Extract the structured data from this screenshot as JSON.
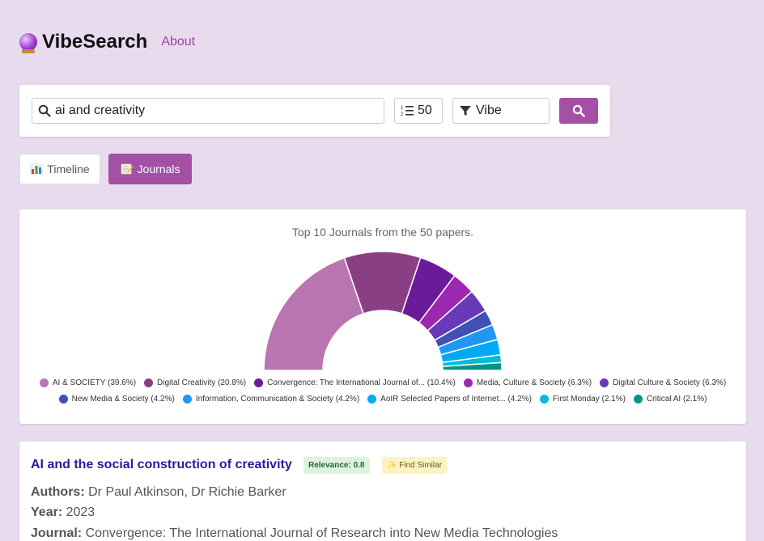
{
  "header": {
    "brand": "VibeSearch",
    "about": "About"
  },
  "search": {
    "query": "ai and creativity",
    "count": "50",
    "mode": "Vibe"
  },
  "tabs": {
    "timeline": "Timeline",
    "journals": "Journals"
  },
  "chart_title": "Top 10 Journals from the 50 papers.",
  "chart_data": {
    "type": "pie",
    "title": "Top 10 Journals from the 50 papers.",
    "categories": [
      "AI & SOCIETY",
      "Digital Creativity",
      "Convergence: The International Journal of...",
      "Media, Culture & Society",
      "Digital Culture & Society",
      "New Media & Society",
      "Information, Communication & Society",
      "AoIR Selected Papers of Internet...",
      "First Monday",
      "Critical AI"
    ],
    "values": [
      39.6,
      20.8,
      10.4,
      6.3,
      6.3,
      4.2,
      4.2,
      4.2,
      2.1,
      2.1
    ],
    "colors": [
      "#b974b2",
      "#8a3f85",
      "#6a1b9a",
      "#9c27b0",
      "#673ab7",
      "#3f51b5",
      "#2196f3",
      "#03a9f4",
      "#00bcd4",
      "#009688"
    ],
    "legend_labels": [
      "AI & SOCIETY (39.6%)",
      "Digital Creativity (20.8%)",
      "Convergence: The International Journal of... (10.4%)",
      "Media, Culture & Society (6.3%)",
      "Digital Culture & Society (6.3%)",
      "New Media & Society (4.2%)",
      "Information, Communication & Society (4.2%)",
      "AoIR Selected Papers of Internet... (4.2%)",
      "First Monday (2.1%)",
      "Critical AI (2.1%)"
    ],
    "legend_placement": "bottom"
  },
  "result": {
    "title": "AI and the social construction of creativity",
    "relevance": "Relevance: 0.8",
    "find_similar": "✨ Find Similar",
    "authors_label": "Authors:",
    "authors": "Dr Paul Atkinson, Dr Richie Barker",
    "year_label": "Year:",
    "year": "2023",
    "journal_label": "Journal:",
    "journal": "Convergence: The International Journal of Research into New Media Technologies"
  },
  "colors": {
    "accent": "#a450a4",
    "background": "#e8dbed",
    "link": "#2a1aa0"
  }
}
